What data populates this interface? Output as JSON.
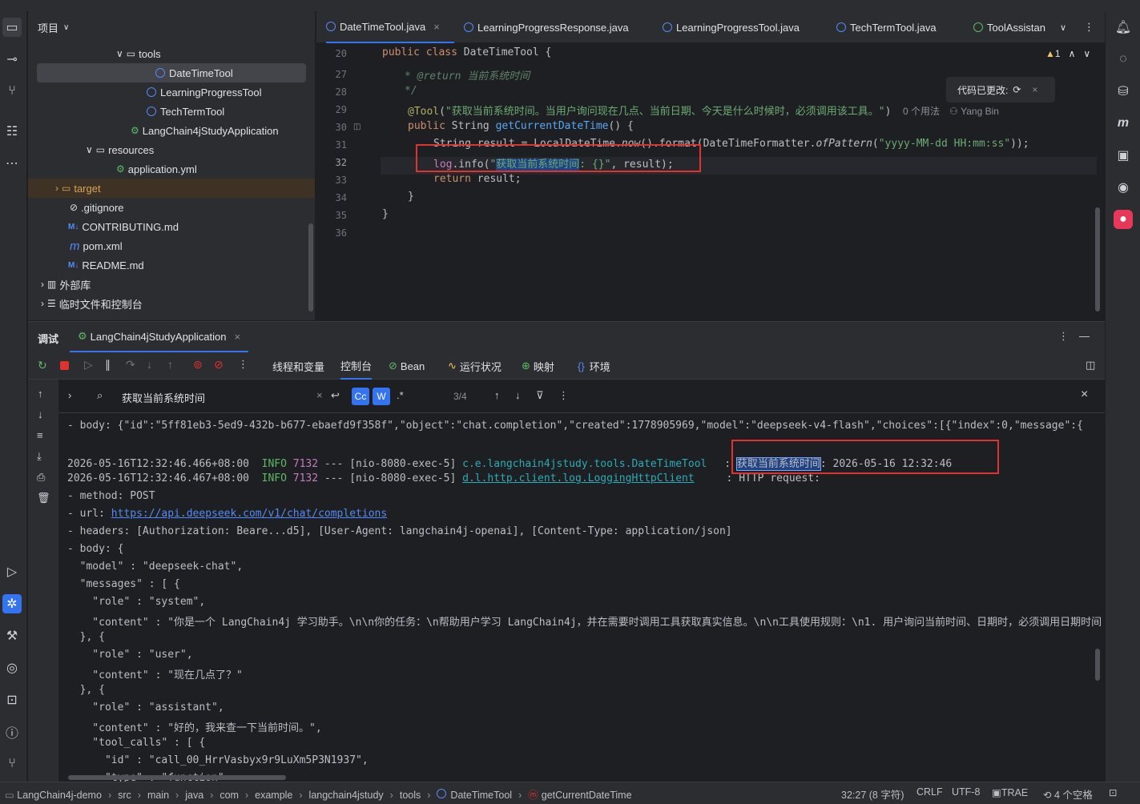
{
  "project": {
    "title": "项目",
    "tree": [
      {
        "label": "tools",
        "kind": "folder"
      },
      {
        "label": "DateTimeTool",
        "kind": "class",
        "selected": true
      },
      {
        "label": "LearningProgressTool",
        "kind": "class"
      },
      {
        "label": "TechTermTool",
        "kind": "class"
      },
      {
        "label": "LangChain4jStudyApplication",
        "kind": "spring"
      },
      {
        "label": "resources",
        "kind": "folder"
      },
      {
        "label": "application.yml",
        "kind": "yml"
      },
      {
        "label": "target",
        "kind": "folder"
      },
      {
        "label": ".gitignore",
        "kind": "ignore"
      },
      {
        "label": "CONTRIBUTING.md",
        "kind": "md"
      },
      {
        "label": "pom.xml",
        "kind": "maven"
      },
      {
        "label": "README.md",
        "kind": "md"
      },
      {
        "label": "外部库",
        "kind": "lib"
      },
      {
        "label": "临时文件和控制台",
        "kind": "scratch"
      }
    ]
  },
  "editor": {
    "tabs": [
      "DateTimeTool.java",
      "LearningProgressResponse.java",
      "LearningProgressTool.java",
      "TechTermTool.java",
      "ToolAssistan"
    ],
    "warnings": "1",
    "popup": "代码已更改:",
    "usages": "0 个用法",
    "author": "Yang Bin",
    "line_numbers": [
      "20",
      "27",
      "28",
      "29",
      "30",
      "31",
      "32",
      "33",
      "34",
      "35",
      "36"
    ]
  },
  "debug": {
    "title": "调试",
    "run_config": "LangChain4jStudyApplication",
    "tabs": [
      "线程和变量",
      "控制台",
      "Bean",
      "运行状况",
      "映射",
      "环境"
    ],
    "search": {
      "query": "获取当前系统时间",
      "count": "3/4",
      "cc": "Cc",
      "w": "W",
      "regex": ".*"
    }
  },
  "console": [
    "- body: {\"id\":\"5ff81eb3-5ed9-432b-b677-ebaefd9f358f\",\"object\":\"chat.completion\",\"created\":1778905969,\"model\":\"deepseek-v4-flash\",\"choices\":[{\"index\":0,\"message\":{",
    "",
    "LOG1",
    "LOG2",
    "- method: POST",
    "URL",
    "- headers: [Authorization: Beare...d5], [User-Agent: langchain4j-openai], [Content-Type: application/json]",
    "- body: {",
    "  \"model\" : \"deepseek-chat\",",
    "  \"messages\" : [ {",
    "    \"role\" : \"system\",",
    "    \"content\" : \"你是一个 LangChain4j 学习助手。\\n\\n你的任务：\\n帮助用户学习 LangChain4j，并在需要时调用工具获取真实信息。\\n\\n工具使用规则：\\n1. 用户询问当前时间、日期时，必须调用日期时间",
    "  }, {",
    "    \"role\" : \"user\",",
    "    \"content\" : \"现在几点了？\"",
    "  }, {",
    "    \"role\" : \"assistant\",",
    "    \"content\" : \"好的，我来查一下当前时间。\",",
    "    \"tool_calls\" : [ {",
    "      \"id\" : \"call_00_HrrVasbyx9r9LuXm5P3N1937\",",
    "      \"type\" : \"function\""
  ],
  "log1": {
    "ts": "2026-05-16T12:32:46.466+08:00",
    "level": "INFO",
    "pid": "7132",
    "thread": "--- [nio-8080-exec-5]",
    "logger": "c.e.langchain4jstudy.tools.DateTimeTool",
    "sep": " : ",
    "msg_hl": "获取当前系统时间",
    "msg": ": 2026-05-16 12:32:46"
  },
  "log2": {
    "ts": "2026-05-16T12:32:46.467+08:00",
    "level": "INFO",
    "pid": "7132",
    "thread": "--- [nio-8080-exec-5]",
    "logger": "d.l.http.client.log.LoggingHttpClient",
    "sep": " : ",
    "msg": "HTTP request:"
  },
  "url_line": {
    "prefix": "- url: ",
    "url": "https://api.deepseek.com/v1/chat/completions"
  },
  "status": {
    "crumbs": [
      "LangChain4j-demo",
      "src",
      "main",
      "java",
      "com",
      "example",
      "langchain4jstudy",
      "tools",
      "DateTimeTool",
      "getCurrentDateTime"
    ],
    "position": "32:27 (8 字符)",
    "eol": "CRLF",
    "encoding": "UTF-8",
    "ai": "TRAE",
    "indent": "4 个空格"
  }
}
